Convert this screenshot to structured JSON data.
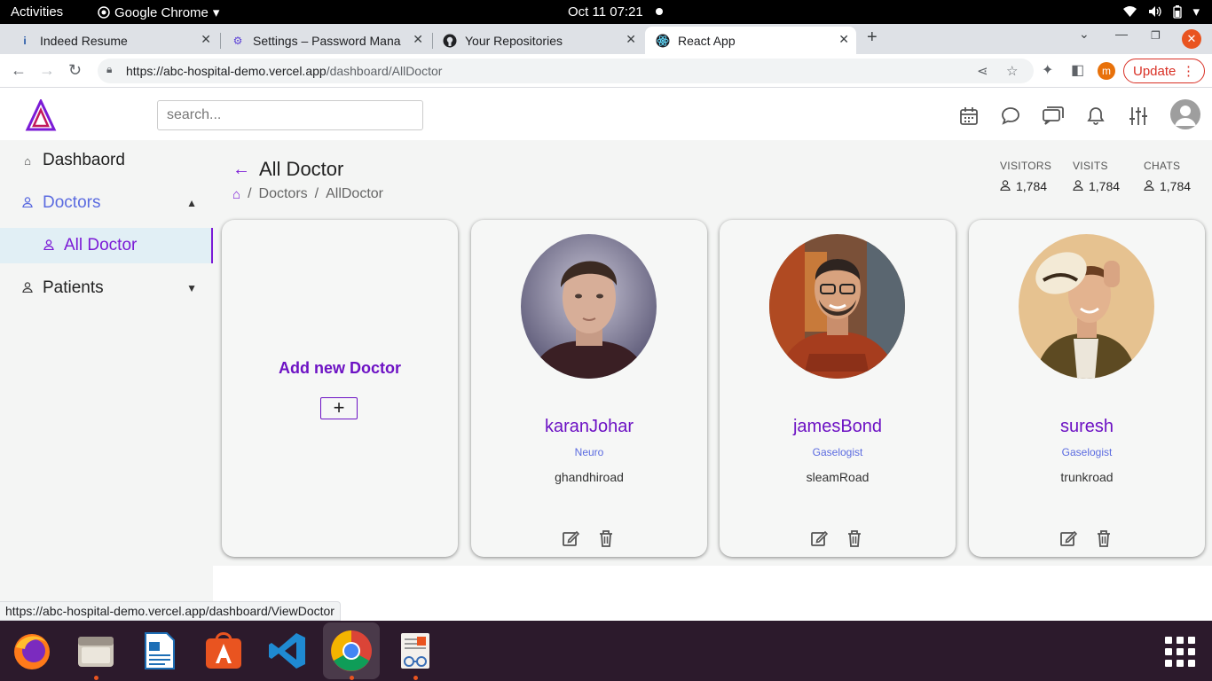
{
  "os_bar": {
    "activities": "Activities",
    "app_name": "Google Chrome",
    "clock": "Oct 11  07:21"
  },
  "browser": {
    "tabs": [
      {
        "title": "Indeed Resume",
        "active": false
      },
      {
        "title": "Settings – Password Mana",
        "active": false
      },
      {
        "title": "Your Repositories",
        "active": false
      },
      {
        "title": "React App",
        "active": true
      }
    ],
    "url_host": "https://abc-hospital-demo.vercel.app",
    "url_path": "/dashboard/AllDoctor",
    "profile_letter": "m",
    "update_label": "Update",
    "status_url": "https://abc-hospital-demo.vercel.app/dashboard/ViewDoctor"
  },
  "header": {
    "search_placeholder": "search..."
  },
  "sidebar": {
    "items": [
      {
        "label": "Dashbaord"
      },
      {
        "label": "Doctors"
      },
      {
        "label": "All Doctor"
      },
      {
        "label": "Patients"
      }
    ]
  },
  "page": {
    "title": "All Doctor",
    "breadcrumb": [
      "Doctors",
      "AllDoctor"
    ],
    "sep": "/",
    "stats": [
      {
        "label": "VISITORS",
        "value": "1,784"
      },
      {
        "label": "VISITS",
        "value": "1,784"
      },
      {
        "label": "CHATS",
        "value": "1,784"
      }
    ],
    "add_card": {
      "title": "Add new Doctor",
      "button": "+"
    },
    "doctors": [
      {
        "name": "karanJohar",
        "specialty": "Neuro",
        "address": "ghandhiroad"
      },
      {
        "name": "jamesBond",
        "specialty": "Gaselogist",
        "address": "sleamRoad"
      },
      {
        "name": "suresh",
        "specialty": "Gaselogist",
        "address": "trunkroad"
      }
    ]
  },
  "colors": {
    "accent": "#6d12c4",
    "link": "#5b6be0",
    "dock": "#2c1a2c"
  }
}
